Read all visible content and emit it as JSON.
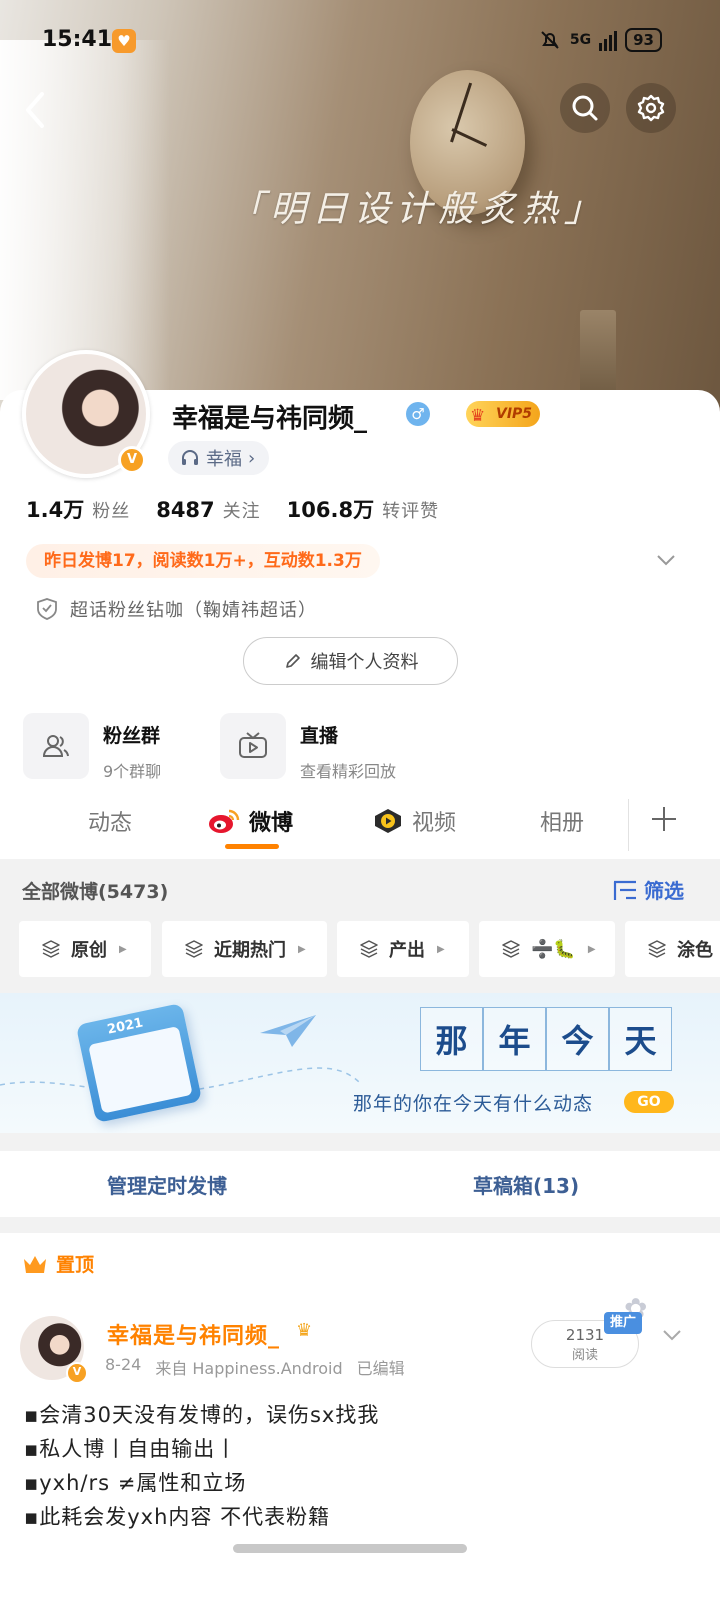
{
  "status_bar": {
    "time": "15:41",
    "network": "5G",
    "battery": "93"
  },
  "cover": {
    "slogan": "「明日设计般炙热」"
  },
  "profile": {
    "nickname": "幸福是与祎同频_",
    "gender_symbol": "♂",
    "vip_label": "VIP5",
    "music_tag": "幸福",
    "music_tag_chevron": "›",
    "stats": [
      {
        "value": "1.4万",
        "label": "粉丝"
      },
      {
        "value": "8487",
        "label": "关注"
      },
      {
        "value": "106.8万",
        "label": "转评赞"
      }
    ],
    "yesterday_summary": "昨日发博17，阅读数1万+，互动数1.3万",
    "supertopic_text": "超话粉丝钻咖（鞠婧祎超话）",
    "edit_profile_label": "编辑个人资料"
  },
  "features": [
    {
      "title": "粉丝群",
      "subtitle": "9个群聊"
    },
    {
      "title": "直播",
      "subtitle": "查看精彩回放"
    }
  ],
  "tabs": [
    {
      "label": "动态",
      "active": false
    },
    {
      "label": "微博",
      "active": true
    },
    {
      "label": "视频",
      "active": false
    },
    {
      "label": "相册",
      "active": false
    }
  ],
  "filter": {
    "all_label": "全部微博(5473)",
    "screen_label": "筛选",
    "chips": [
      "原创",
      "近期热门",
      "产出",
      "➗🐛",
      "涂色"
    ]
  },
  "banner": {
    "calendar_year": "2021",
    "title_chars": [
      "那",
      "年",
      "今",
      "天"
    ],
    "subtitle": "那年的你在今天有什么动态",
    "go_label": "GO"
  },
  "manage": {
    "scheduled_label": "管理定时发博",
    "drafts_label": "草稿箱(13)"
  },
  "post": {
    "pinned_label": "置顶",
    "author": "幸福是与祎同频_",
    "date": "8-24",
    "source": "来自 Happiness.Android",
    "edited": "已编辑",
    "reads_count": "2131",
    "reads_label": "阅读",
    "promo_label": "推广",
    "lines": [
      "▪会清30天没有发博的，误伤sx找我",
      "▪私人博丨自由输出丨",
      "▪yxh/rs ≠属性和立场",
      "▪此耗会发yxh内容 不代表粉籍"
    ]
  },
  "colors": {
    "accent": "#ff8200",
    "link_blue": "#3a6bd1",
    "vip_gold": "#f4a51b"
  }
}
